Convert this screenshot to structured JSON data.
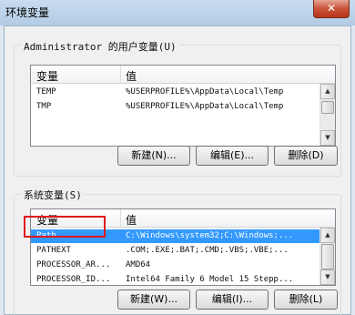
{
  "window": {
    "title": "环境变量",
    "close_glyph": "✕"
  },
  "user_vars": {
    "group_label": "Administrator 的用户变量(U)",
    "headers": [
      "变量",
      "值"
    ],
    "rows": [
      {
        "name": "TEMP",
        "value": "%USERPROFILE%\\AppData\\Local\\Temp"
      },
      {
        "name": "TMP",
        "value": "%USERPROFILE%\\AppData\\Local\\Temp"
      }
    ],
    "buttons": {
      "new": "新建(N)...",
      "edit": "编辑(E)...",
      "delete": "删除(D)"
    }
  },
  "system_vars": {
    "group_label": "系统变量(S)",
    "headers": [
      "变量",
      "值"
    ],
    "rows": [
      {
        "name": "Path",
        "value": "C:\\Windows\\system32;C:\\Windows;..."
      },
      {
        "name": "PATHEXT",
        "value": ".COM;.EXE;.BAT;.CMD;.VBS;.VBE;..."
      },
      {
        "name": "PROCESSOR_AR...",
        "value": "AMD64"
      },
      {
        "name": "PROCESSOR_ID...",
        "value": "Intel64 Family 6 Model 15 Stepp..."
      }
    ],
    "buttons": {
      "new": "新建(W)...",
      "edit": "编辑(I)...",
      "delete": "删除(L)"
    }
  },
  "scroll": {
    "up": "▲",
    "down": "▼"
  },
  "colors": {
    "highlight": "#e01818",
    "selection": "#3399ff"
  }
}
